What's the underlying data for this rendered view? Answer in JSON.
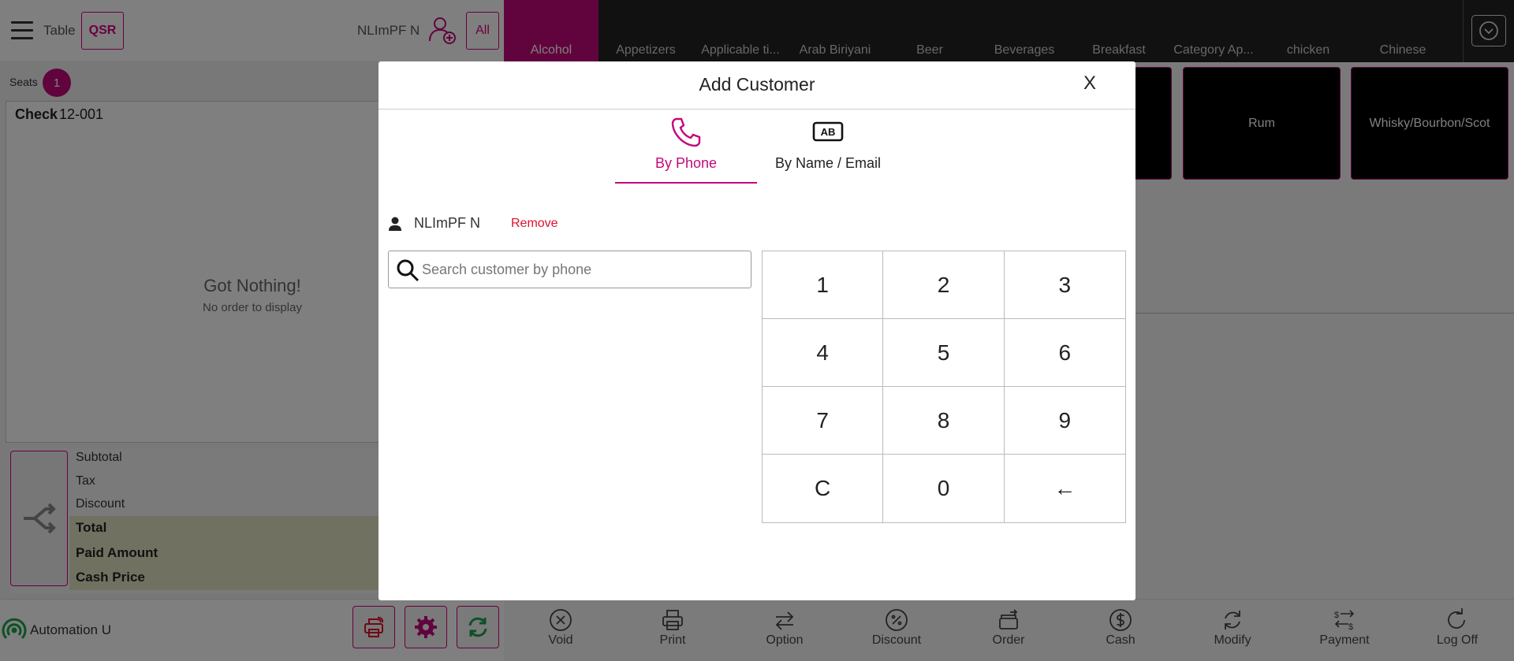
{
  "header": {
    "table_label": "Table",
    "qsr_label": "QSR",
    "customer_name": "NLImPF N",
    "all_label": "All"
  },
  "categories": [
    "Alcohol",
    "Appetizers",
    "Applicable ti...",
    "Arab Biriyani",
    "Beer",
    "Beverages",
    "Breakfast",
    "Category Ap...",
    "chicken",
    "Chinese"
  ],
  "active_category": "Alcohol",
  "left_panel": {
    "seats_label": "Seats",
    "seat_count": "1",
    "check_label": "Check",
    "check_number": "12-001",
    "empty_title": "Got Nothing!",
    "empty_subtitle": "No order to display",
    "subtotal_label": "Subtotal",
    "tax_label": "Tax",
    "discount_label": "Discount",
    "total_label": "Total",
    "paid_label": "Paid Amount",
    "cash_label": "Cash Price"
  },
  "footer_left": {
    "user": "Automation U"
  },
  "items": [
    "Rum",
    "Whisky/Bourbon/Scot"
  ],
  "actions": [
    "Void",
    "Print",
    "Option",
    "Discount",
    "Order",
    "Cash",
    "Modify",
    "Payment",
    "Log Off"
  ],
  "modal": {
    "title": "Add Customer",
    "close": "X",
    "tab_phone": "By Phone",
    "tab_name": "By Name / Email",
    "tab_name_icon_text": "AB",
    "selected_customer": "NLImPF N",
    "remove_label": "Remove",
    "search_placeholder": "Search customer by phone",
    "keys": [
      "1",
      "2",
      "3",
      "4",
      "5",
      "6",
      "7",
      "8",
      "9",
      "C",
      "0",
      "←"
    ]
  },
  "colors": {
    "accent": "#c3097c",
    "remove": "#e0102a",
    "category_bar": "#232323"
  }
}
